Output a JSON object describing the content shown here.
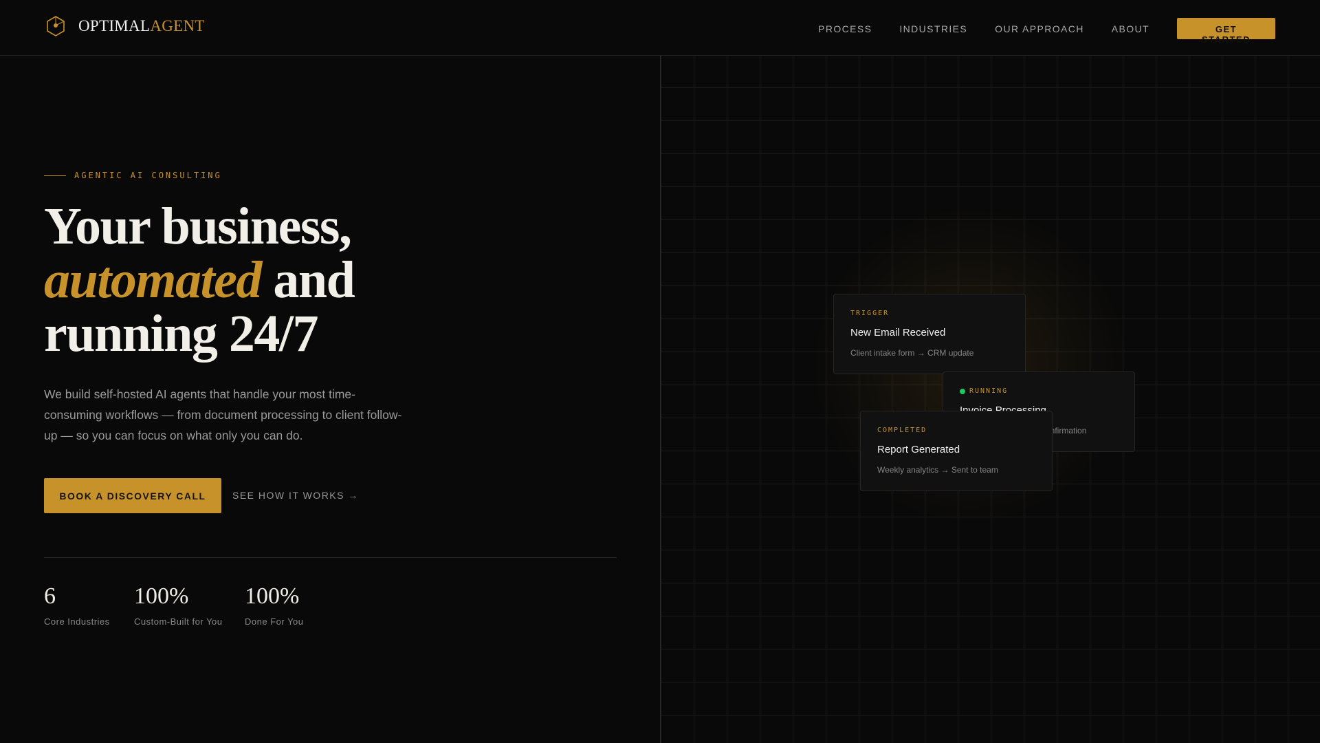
{
  "brand": {
    "name_part1": "OPTIMAL",
    "name_part2": "AGENT",
    "accent": "#c8922a"
  },
  "nav": {
    "links": [
      "PROCESS",
      "INDUSTRIES",
      "OUR APPROACH",
      "ABOUT"
    ],
    "cta": "GET STARTED"
  },
  "hero": {
    "eyebrow": "AGENTIC AI CONSULTING",
    "headline_line1": "Your business,",
    "headline_accent": "automated",
    "headline_and": " and",
    "headline_line3": "running 24/7",
    "description": "We build self-hosted AI agents that handle your most time-consuming workflows — from document processing to client follow-up — so you can focus on what only you can do.",
    "primary_cta": "BOOK A DISCOVERY CALL",
    "secondary_cta": "SEE HOW IT WORKS →"
  },
  "stats": [
    {
      "value": "6",
      "label": "Core Industries"
    },
    {
      "value": "100%",
      "label": "Custom-Built for You"
    },
    {
      "value": "100%",
      "label": "Done For You"
    }
  ],
  "cards": {
    "trigger": {
      "tag": "TRIGGER",
      "title": "New Email Received",
      "sub": "Client intake form → CRM update"
    },
    "running": {
      "tag": "RUNNING",
      "title": "Invoice Processing",
      "sub": "onfirmation",
      "status_color": "#22c55e"
    },
    "completed": {
      "tag": "COMPLETED",
      "title": "Report Generated",
      "sub": "Weekly analytics → Sent to team"
    }
  }
}
